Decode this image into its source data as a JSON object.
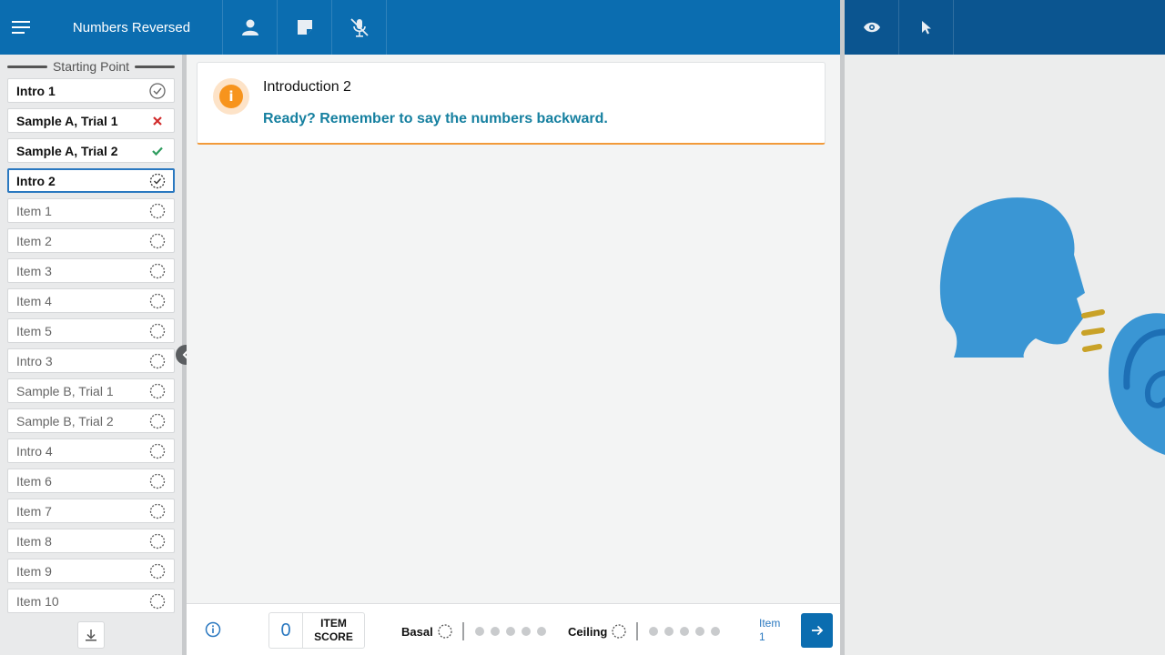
{
  "header": {
    "title": "Numbers Reversed",
    "icons": [
      "menu-icon",
      "person-icon",
      "note-icon",
      "mic-off-icon"
    ],
    "right_icons": [
      "eye-icon",
      "pointer-icon"
    ]
  },
  "sidebar": {
    "header": "Starting Point",
    "items": [
      {
        "label": "Intro 1",
        "status": "check-circle"
      },
      {
        "label": "Sample A, Trial 1",
        "status": "incorrect"
      },
      {
        "label": "Sample A, Trial 2",
        "status": "correct"
      },
      {
        "label": "Intro 2",
        "status": "in-progress"
      },
      {
        "label": "Item 1",
        "status": "pending"
      },
      {
        "label": "Item 2",
        "status": "pending"
      },
      {
        "label": "Item 3",
        "status": "pending"
      },
      {
        "label": "Item 4",
        "status": "pending"
      },
      {
        "label": "Item 5",
        "status": "pending"
      },
      {
        "label": "Intro 3",
        "status": "pending"
      },
      {
        "label": "Sample B, Trial 1",
        "status": "pending"
      },
      {
        "label": "Sample B, Trial 2",
        "status": "pending"
      },
      {
        "label": "Intro 4",
        "status": "pending"
      },
      {
        "label": "Item 6",
        "status": "pending"
      },
      {
        "label": "Item 7",
        "status": "pending"
      },
      {
        "label": "Item 8",
        "status": "pending"
      },
      {
        "label": "Item 9",
        "status": "pending"
      },
      {
        "label": "Item 10",
        "status": "pending"
      }
    ]
  },
  "card": {
    "title": "Introduction 2",
    "text": "Ready? Remember to say the numbers backward."
  },
  "footer": {
    "score_value": "0",
    "score_label_line1": "ITEM",
    "score_label_line2": "SCORE",
    "basal_label": "Basal",
    "ceiling_label": "Ceiling",
    "next_label_line1": "Item",
    "next_label_line2": "1"
  },
  "colors": {
    "header_blue": "#0b6db0",
    "accent_orange": "#f7941d",
    "prompt_teal": "#1680a0",
    "figure_blue": "#3a96d4",
    "sound_gold": "#c9a227"
  }
}
